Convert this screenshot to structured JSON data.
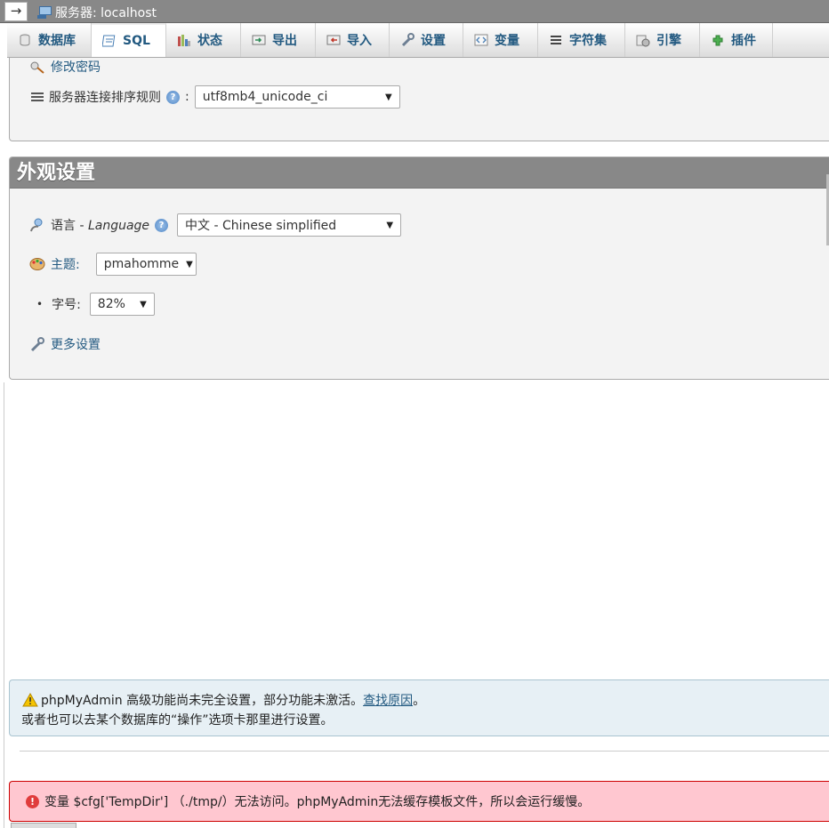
{
  "topbar": {
    "collapse_glyph": "→",
    "server_label": "服务器: localhost",
    "server_icon": "server-icon"
  },
  "tabs": [
    {
      "label": "数据库",
      "icon": "database-icon",
      "active": false
    },
    {
      "label": "SQL",
      "icon": "sql-icon",
      "active": true
    },
    {
      "label": "状态",
      "icon": "status-icon",
      "active": false
    },
    {
      "label": "导出",
      "icon": "export-icon",
      "active": false
    },
    {
      "label": "导入",
      "icon": "import-icon",
      "active": false
    },
    {
      "label": "设置",
      "icon": "settings-wrench-icon",
      "active": false
    },
    {
      "label": "变量",
      "icon": "variables-icon",
      "active": false
    },
    {
      "label": "字符集",
      "icon": "charset-icon",
      "active": false
    },
    {
      "label": "引擎",
      "icon": "engine-icon",
      "active": false
    },
    {
      "label": "插件",
      "icon": "plugin-icon",
      "active": false
    }
  ],
  "general": {
    "change_password": "修改密码",
    "collation_label": "服务器连接排序规则",
    "collation_colon": ":",
    "collation_value": "utf8mb4_unicode_ci"
  },
  "appearance": {
    "title": "外观设置",
    "language_label": "语言 - ",
    "language_label_italic": "Language",
    "language_value": "中文 - Chinese simplified",
    "theme_label": "主题:",
    "theme_value": "pmahomme",
    "font_size_label": "字号:",
    "font_size_value": "82%",
    "more_settings": "更多设置"
  },
  "notice": {
    "line1": "phpMyAdmin 高级功能尚未完全设置，部分功能未激活。",
    "link": "查找原因",
    "line1_end": "。",
    "line2": "或者也可以去某个数据库的“操作”选项卡那里进行设置。"
  },
  "error": {
    "text": "变量 $cfg['TempDir'] （./tmp/）无法访问。phpMyAdmin无法缓存模板文件，所以会运行缓慢。"
  },
  "colors": {
    "header_gray": "#888888",
    "link_blue": "#235a81",
    "error_bg": "#ffc7d0",
    "notice_bg": "#e7f0f5"
  }
}
